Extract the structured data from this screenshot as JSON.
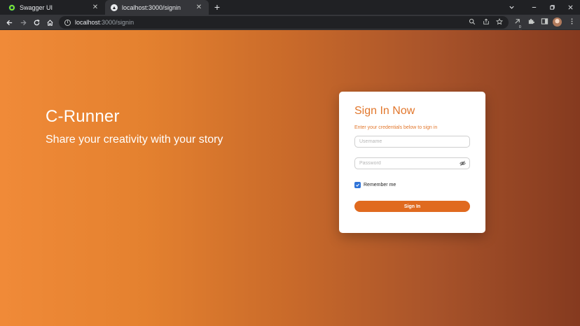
{
  "browser": {
    "tabs": [
      {
        "title": "Swagger UI",
        "close_glyph": "✕"
      },
      {
        "title": "localhost:3000/signin",
        "close_glyph": "✕"
      }
    ],
    "new_tab_glyph": "+",
    "url_host": "localhost",
    "url_path": ":3000/signin"
  },
  "page": {
    "hero_title": "C-Runner",
    "hero_subtitle": "Share your creativity with your story"
  },
  "signin": {
    "title": "Sign In Now",
    "subtitle": "Enter your credentials below to sign in",
    "username_placeholder": "Username",
    "password_placeholder": "Password",
    "remember_label": "Remember me",
    "remember_checked": true,
    "button_label": "Sign In"
  },
  "colors": {
    "accent": "#e2772c",
    "button": "#e06a1f",
    "checkbox": "#2f74d8",
    "gradient_start": "#f08a38",
    "gradient_end": "#853a1f"
  }
}
